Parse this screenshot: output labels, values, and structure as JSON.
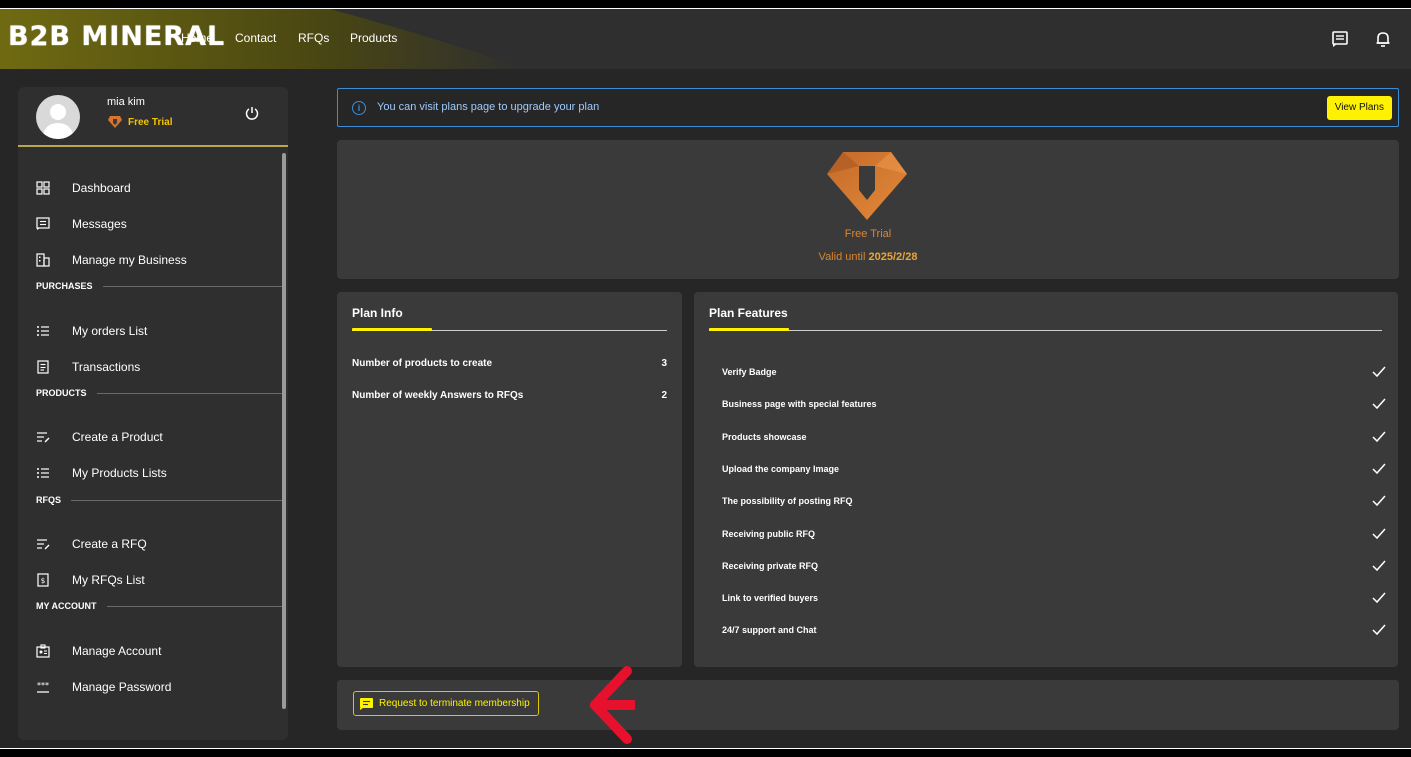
{
  "header": {
    "logo": "B2B MINERAL",
    "nav": [
      "Home",
      "Contact",
      "RFQs",
      "Products"
    ],
    "icons": [
      "message-icon",
      "bell-icon"
    ]
  },
  "sidebar": {
    "user_name": "mia kim",
    "plan_label": "Free Trial",
    "items": [
      {
        "label": "Dashboard",
        "icon": "dashboard-icon"
      },
      {
        "label": "Messages",
        "icon": "messages-icon"
      },
      {
        "label": "Manage my Business",
        "icon": "business-icon"
      }
    ],
    "sections": {
      "purchases": {
        "title": "PURCHASES",
        "items": [
          {
            "label": "My orders List"
          },
          {
            "label": "Transactions"
          }
        ]
      },
      "products": {
        "title": "PRODUCTS",
        "items": [
          {
            "label": "Create a Product"
          },
          {
            "label": "My Products Lists"
          }
        ]
      },
      "rfqs": {
        "title": "RFQS",
        "items": [
          {
            "label": "Create a RFQ"
          },
          {
            "label": "My RFQs List"
          }
        ]
      },
      "account": {
        "title": "MY ACCOUNT",
        "items": [
          {
            "label": "Manage Account"
          },
          {
            "label": "Manage Password"
          }
        ]
      }
    }
  },
  "notice": {
    "text": "You can visit plans page to upgrade your plan",
    "button": "View Plans"
  },
  "plan": {
    "name": "Free Trial",
    "valid_prefix": "Valid until",
    "valid_date": "2025/2/28"
  },
  "plan_info": {
    "title": "Plan Info",
    "rows": [
      {
        "label": "Number of products to create",
        "value": "3"
      },
      {
        "label": "Number of weekly Answers to RFQs",
        "value": "2"
      }
    ]
  },
  "plan_features": {
    "title": "Plan Features",
    "items": [
      "Verify Badge",
      "Business page with special features",
      "Products showcase",
      "Upload the company Image",
      "The possibility of posting RFQ",
      "Receiving public RFQ",
      "Receiving private RFQ",
      "Link to verified buyers",
      "24/7 support and Chat"
    ]
  },
  "terminate": {
    "label": "Request to terminate membership"
  },
  "colors": {
    "accent": "#fff200",
    "plan": "#e0842b",
    "info": "#3b8ed6",
    "annotation": "#e8112d"
  }
}
